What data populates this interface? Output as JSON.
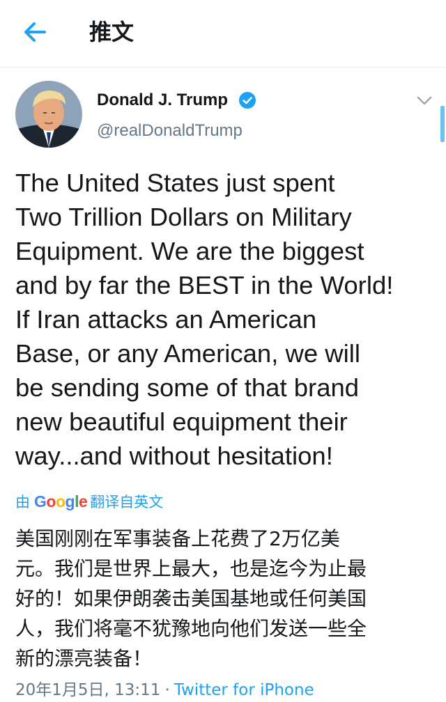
{
  "header": {
    "title": "推文"
  },
  "tweet": {
    "author_name": "Donald J. Trump",
    "author_handle": "@realDonaldTrump",
    "text": "The United States just spent\nTwo Trillion Dollars on Military\nEquipment. We are the biggest\nand by far the BEST in the World!\nIf Iran attacks an American\nBase, or any American, we will\nbe sending some of that brand\nnew beautiful equipment their\nway...and without hesitation!",
    "translate_prefix": "由",
    "translate_brand": "Google",
    "translate_suffix": "翻译自英文",
    "translated_text": "美国刚刚在军事装备上花费了2万亿美\n元。我们是世界上最大，也是迄今为止最\n好的！如果伊朗袭击美国基地或任何美国\n人，我们将毫不犹豫地向他们发送一些全\n新的漂亮装备！",
    "timestamp": "20年1月5日, 13:11",
    "separator": "·",
    "source": "Twitter for iPhone"
  },
  "icons": {
    "back": "arrow-left-icon",
    "verified": "verified-badge-icon",
    "more": "chevron-down-icon"
  },
  "colors": {
    "accent": "#1da1f2",
    "text_primary": "#14171a",
    "text_secondary": "#657786",
    "google_blue": "#4285f4",
    "google_red": "#ea4335",
    "google_yellow": "#fbbc05",
    "google_green": "#34a853"
  }
}
